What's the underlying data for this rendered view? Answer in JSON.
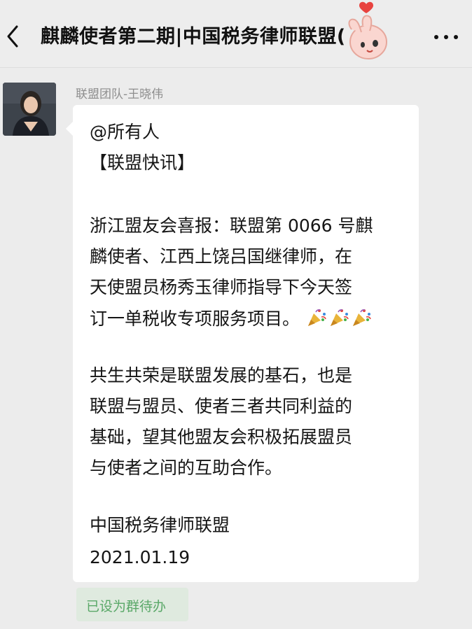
{
  "header": {
    "title": "麒麟使者第二期|中国税务律师联盟(",
    "back_icon": "chevron-left-icon",
    "more_icon": "ellipsis-icon",
    "sticker": "finger-heart-sticker"
  },
  "message": {
    "sender": "联盟团队-王晓伟",
    "lines": [
      "@所有人",
      "【联盟快讯】",
      "浙江盟友会喜报：联盟第 0066 号麒",
      "麟使者、江西上饶吕国继律师，在",
      "天使盟员杨秀玉律师指导下今天签",
      "订一单税收专项服务项目。",
      "共生共荣是联盟发展的基石，也是",
      "联盟与盟员、使者三者共同利益的",
      "基础，望其他盟友会积极拓展盟员",
      "与使者之间的互助合作。",
      "中国税务律师联盟",
      "2021.01.19"
    ],
    "emoji": "party-popper-icon ×3"
  },
  "badge": {
    "label": "已设为群待办"
  },
  "colors": {
    "background": "#ececec",
    "bubble": "#ffffff",
    "badge_bg": "#dfeadf",
    "badge_text": "#5aa868",
    "sender_text": "#8e8e8e"
  }
}
